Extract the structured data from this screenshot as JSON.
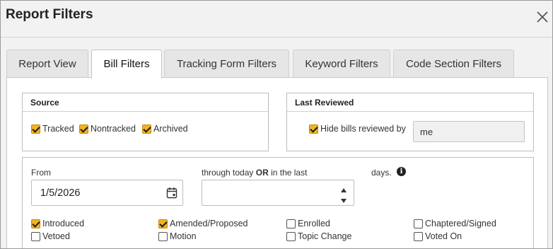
{
  "dialog": {
    "title": "Report Filters"
  },
  "tabs": [
    {
      "label": "Report View",
      "active": false
    },
    {
      "label": "Bill Filters",
      "active": true
    },
    {
      "label": "Tracking Form Filters",
      "active": false
    },
    {
      "label": "Keyword Filters",
      "active": false
    },
    {
      "label": "Code Section Filters",
      "active": false
    }
  ],
  "source": {
    "title": "Source",
    "options": [
      {
        "label": "Tracked",
        "checked": true
      },
      {
        "label": "Nontracked",
        "checked": true
      },
      {
        "label": "Archived",
        "checked": true
      }
    ]
  },
  "last_reviewed": {
    "title": "Last Reviewed",
    "hide_label": "Hide bills reviewed by",
    "hide_checked": true,
    "reviewer_value": "me"
  },
  "dates": {
    "from_label": "From",
    "from_value": "1/5/2026",
    "through_prefix": "through today ",
    "through_bold": "OR",
    "through_suffix": " in the last",
    "days_value": "",
    "days_label": "days."
  },
  "statuses": [
    {
      "label": "Introduced",
      "checked": true
    },
    {
      "label": "Amended/Proposed",
      "checked": true
    },
    {
      "label": "Enrolled",
      "checked": false
    },
    {
      "label": "Chaptered/Signed",
      "checked": false
    },
    {
      "label": "Vetoed",
      "checked": false
    },
    {
      "label": "Motion",
      "checked": false
    },
    {
      "label": "Topic Change",
      "checked": false
    },
    {
      "label": "Voted On",
      "checked": false
    }
  ],
  "colors": {
    "accent": "#f0b323",
    "panel_bg": "#ffffff",
    "dialog_bg": "#f2f2f2"
  }
}
